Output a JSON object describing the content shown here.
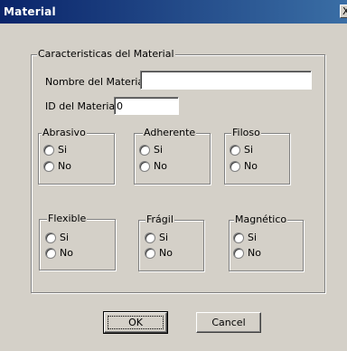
{
  "window": {
    "title": "Material",
    "close_label": "X"
  },
  "main_group": {
    "legend": "Caracteristicas del Material"
  },
  "form": {
    "name_label": "Nombre del Material:",
    "name_value": "",
    "id_label": "ID del Material:",
    "id_value": "0"
  },
  "groups": {
    "abrasivo": {
      "legend": "Abrasivo",
      "yes": "Si",
      "no": "No"
    },
    "adherente": {
      "legend": "Adherente",
      "yes": "Si",
      "no": "No"
    },
    "filoso": {
      "legend": "Filoso",
      "yes": "Si",
      "no": "No"
    },
    "flexible": {
      "legend": "Flexible",
      "yes": "Si",
      "no": "No"
    },
    "fragil": {
      "legend": "Frágil",
      "yes": "Si",
      "no": "No"
    },
    "magnetico": {
      "legend": "Magnético",
      "yes": "Si",
      "no": "No"
    }
  },
  "buttons": {
    "ok": "OK",
    "cancel": "Cancel"
  },
  "colors": {
    "title_start": "#0a246a",
    "title_end": "#3a6ea5",
    "face": "#d4d0c8"
  }
}
